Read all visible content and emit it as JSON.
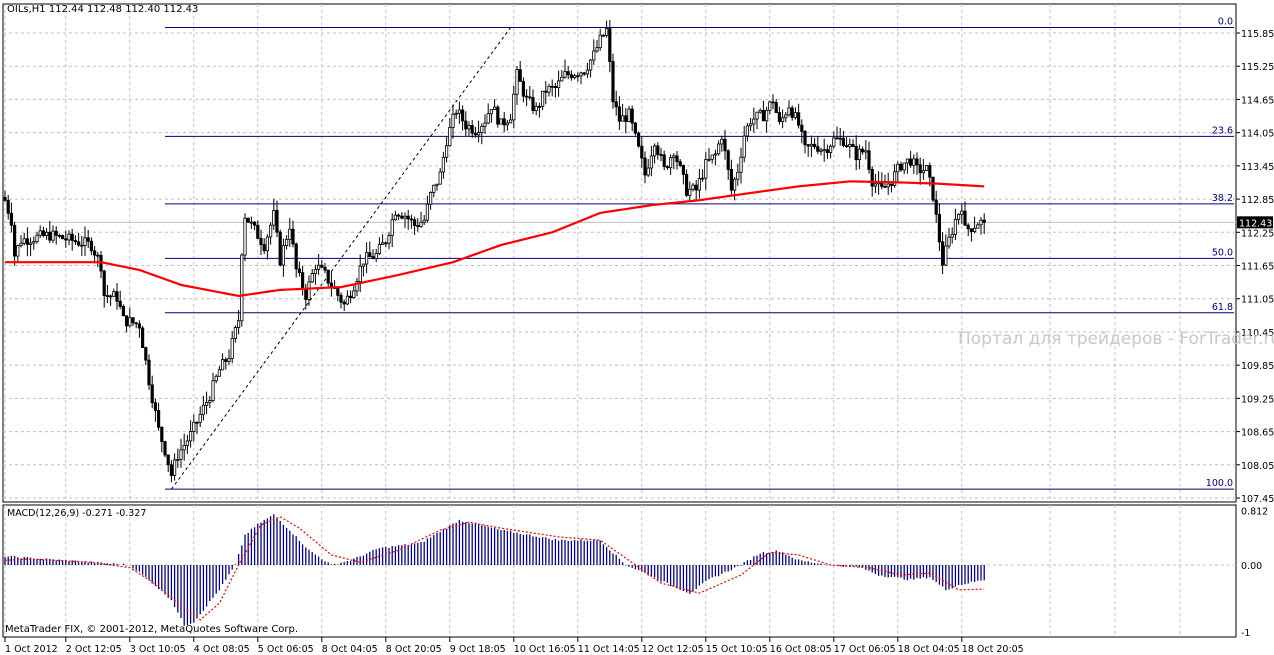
{
  "header": {
    "symbol": "OILs,H1",
    "ohlc": "112.44 112.48 112.40 112.43"
  },
  "macd_header": "MACD(12,26,9) -0.271 -0.327",
  "copyright": "MetaTrader FIX, © 2001-2012, MetaQuotes Software Corp.",
  "watermark": "Портал для трейдеров - ForTrader.ru",
  "current_price_label": "112.43",
  "chart_data": [
    {
      "type": "candlestick",
      "title": "OILs,H1",
      "timeframe": "H1",
      "current_price": 112.43,
      "ylim": [
        107.3,
        116.35
      ],
      "y_ticks": [
        "115.85",
        "115.25",
        "114.65",
        "114.05",
        "113.45",
        "112.85",
        "112.25",
        "111.65",
        "111.05",
        "110.45",
        "109.85",
        "109.25",
        "108.65",
        "108.05",
        "107.45"
      ],
      "x_ticks": [
        {
          "bar": 0,
          "label": "1 Oct 2012"
        },
        {
          "bar": 19,
          "label": "2 Oct 12:05"
        },
        {
          "bar": 39,
          "label": "3 Oct 10:05"
        },
        {
          "bar": 59,
          "label": "4 Oct 08:05"
        },
        {
          "bar": 79,
          "label": "5 Oct 06:05"
        },
        {
          "bar": 99,
          "label": "8 Oct 04:05"
        },
        {
          "bar": 119,
          "label": "8 Oct 20:05"
        },
        {
          "bar": 139,
          "label": "9 Oct 18:05"
        },
        {
          "bar": 159,
          "label": "10 Oct 16:05"
        },
        {
          "bar": 179,
          "label": "11 Oct 14:05"
        },
        {
          "bar": 199,
          "label": "12 Oct 12:05"
        },
        {
          "bar": 219,
          "label": "15 Oct 10:05"
        },
        {
          "bar": 239,
          "label": "16 Oct 08:05"
        },
        {
          "bar": 259,
          "label": "17 Oct 06:05"
        },
        {
          "bar": 279,
          "label": "18 Oct 04:05"
        },
        {
          "bar": 299,
          "label": "18 Oct 20:05"
        }
      ],
      "bar_count": 307,
      "close_path": [
        [
          0,
          112.83
        ],
        [
          2,
          112.47
        ],
        [
          3,
          111.84
        ],
        [
          5,
          112.11
        ],
        [
          14,
          112.2
        ],
        [
          27,
          112.02
        ],
        [
          30,
          111.66
        ],
        [
          31,
          111.12
        ],
        [
          35,
          111.08
        ],
        [
          37,
          110.67
        ],
        [
          42,
          110.58
        ],
        [
          45,
          109.58
        ],
        [
          48,
          108.68
        ],
        [
          50,
          108.32
        ],
        [
          52,
          107.87
        ],
        [
          54,
          108.23
        ],
        [
          58,
          108.59
        ],
        [
          61,
          108.95
        ],
        [
          64,
          109.31
        ],
        [
          67,
          109.76
        ],
        [
          70,
          110.03
        ],
        [
          73,
          110.67
        ],
        [
          74,
          111.93
        ],
        [
          75,
          112.56
        ],
        [
          78,
          112.29
        ],
        [
          81,
          112.02
        ],
        [
          84,
          112.56
        ],
        [
          86,
          111.75
        ],
        [
          89,
          112.38
        ],
        [
          91,
          111.57
        ],
        [
          94,
          111.12
        ],
        [
          97,
          111.66
        ],
        [
          100,
          111.48
        ],
        [
          103,
          111.21
        ],
        [
          106,
          110.94
        ],
        [
          109,
          111.3
        ],
        [
          112,
          111.75
        ],
        [
          116,
          111.84
        ],
        [
          119,
          112.11
        ],
        [
          122,
          112.65
        ],
        [
          125,
          112.56
        ],
        [
          128,
          112.38
        ],
        [
          131,
          112.47
        ],
        [
          133,
          112.92
        ],
        [
          136,
          113.29
        ],
        [
          138,
          113.92
        ],
        [
          141,
          114.46
        ],
        [
          144,
          114.19
        ],
        [
          147,
          114.1
        ],
        [
          150,
          114.28
        ],
        [
          152,
          114.55
        ],
        [
          155,
          114.19
        ],
        [
          158,
          114.37
        ],
        [
          160,
          115.09
        ],
        [
          163,
          114.64
        ],
        [
          166,
          114.46
        ],
        [
          169,
          114.82
        ],
        [
          172,
          114.85
        ],
        [
          175,
          115.09
        ],
        [
          181,
          115.18
        ],
        [
          184,
          115.45
        ],
        [
          186,
          115.72
        ],
        [
          188,
          115.9
        ],
        [
          190,
          114.64
        ],
        [
          192,
          114.28
        ],
        [
          195,
          114.37
        ],
        [
          198,
          113.74
        ],
        [
          200,
          113.29
        ],
        [
          203,
          113.92
        ],
        [
          206,
          113.38
        ],
        [
          209,
          113.74
        ],
        [
          213,
          113.01
        ],
        [
          216,
          113.01
        ],
        [
          219,
          113.47
        ],
        [
          222,
          113.65
        ],
        [
          224,
          114.01
        ],
        [
          227,
          113.01
        ],
        [
          229,
          113.38
        ],
        [
          231,
          114.01
        ],
        [
          233,
          114.28
        ],
        [
          237,
          114.37
        ],
        [
          240,
          114.64
        ],
        [
          242,
          114.19
        ],
        [
          245,
          114.55
        ],
        [
          248,
          114.19
        ],
        [
          250,
          113.74
        ],
        [
          253,
          113.83
        ],
        [
          256,
          113.74
        ],
        [
          259,
          113.92
        ],
        [
          262,
          113.92
        ],
        [
          266,
          113.65
        ],
        [
          269,
          113.74
        ],
        [
          271,
          113.19
        ],
        [
          274,
          113.01
        ],
        [
          277,
          113.19
        ],
        [
          280,
          113.47
        ],
        [
          283,
          113.56
        ],
        [
          285,
          113.38
        ],
        [
          288,
          113.38
        ],
        [
          290,
          112.92
        ],
        [
          292,
          112.11
        ],
        [
          293,
          111.71
        ],
        [
          295,
          112.11
        ],
        [
          297,
          112.47
        ],
        [
          299,
          112.74
        ],
        [
          300,
          112.29
        ],
        [
          303,
          112.38
        ],
        [
          304,
          112.43
        ],
        [
          306,
          112.43
        ]
      ],
      "moving_average": {
        "color": "#ff0000",
        "path": [
          [
            0,
            111.71
          ],
          [
            14,
            111.71
          ],
          [
            30,
            111.71
          ],
          [
            42,
            111.57
          ],
          [
            55,
            111.3
          ],
          [
            73,
            111.1
          ],
          [
            86,
            111.21
          ],
          [
            105,
            111.26
          ],
          [
            123,
            111.48
          ],
          [
            140,
            111.71
          ],
          [
            155,
            112.02
          ],
          [
            171,
            112.25
          ],
          [
            186,
            112.6
          ],
          [
            202,
            112.74
          ],
          [
            217,
            112.83
          ],
          [
            233,
            112.96
          ],
          [
            248,
            113.08
          ],
          [
            264,
            113.17
          ],
          [
            280,
            113.15
          ],
          [
            291,
            113.13
          ],
          [
            306,
            113.08
          ]
        ]
      },
      "trendline": {
        "from": [
          52,
          107.61
        ],
        "to": [
          158,
          115.95
        ],
        "style": "dashed"
      },
      "fibonacci": {
        "start_bar": 50,
        "price_0": 115.95,
        "price_100": 107.61,
        "color": "#000080",
        "levels": [
          {
            "pct": 0,
            "label": "0.0"
          },
          {
            "pct": 23.6,
            "label": "23.6"
          },
          {
            "pct": 38.2,
            "label": "38.2"
          },
          {
            "pct": 50,
            "label": "50.0"
          },
          {
            "pct": 61.8,
            "label": "61.8"
          },
          {
            "pct": 100,
            "label": "100.0"
          }
        ]
      }
    },
    {
      "type": "bar",
      "title": "MACD(12,26,9)",
      "macd": -0.271,
      "signal": -0.327,
      "ylim": [
        -1.0,
        0.88
      ],
      "y_ticks": [
        {
          "value": 0.812,
          "label": "0.812"
        },
        {
          "value": 0,
          "label": "0.00"
        },
        {
          "value": -1,
          "label": "-1"
        }
      ],
      "histogram_color": "#000080",
      "signal_color": "#ff0000",
      "histogram_path": [
        [
          0,
          0.13
        ],
        [
          27,
          0.04
        ],
        [
          39,
          0
        ],
        [
          45,
          -0.22
        ],
        [
          52,
          -0.52
        ],
        [
          56,
          -0.9
        ],
        [
          59,
          -0.85
        ],
        [
          67,
          -0.37
        ],
        [
          72,
          0
        ],
        [
          75,
          0.45
        ],
        [
          80,
          0.64
        ],
        [
          84,
          0.75
        ],
        [
          89,
          0.52
        ],
        [
          95,
          0.22
        ],
        [
          102,
          0
        ],
        [
          108,
          0.07
        ],
        [
          117,
          0.25
        ],
        [
          130,
          0.33
        ],
        [
          142,
          0.67
        ],
        [
          155,
          0.52
        ],
        [
          173,
          0.37
        ],
        [
          186,
          0.37
        ],
        [
          194,
          0
        ],
        [
          199,
          -0.1
        ],
        [
          208,
          -0.3
        ],
        [
          214,
          -0.42
        ],
        [
          220,
          -0.22
        ],
        [
          230,
          0
        ],
        [
          236,
          0.18
        ],
        [
          242,
          0.21
        ],
        [
          248,
          0.07
        ],
        [
          258,
          0
        ],
        [
          267,
          -0.03
        ],
        [
          273,
          -0.15
        ],
        [
          283,
          -0.22
        ],
        [
          289,
          -0.18
        ],
        [
          294,
          -0.37
        ],
        [
          298,
          -0.3
        ],
        [
          306,
          -0.22
        ]
      ],
      "signal_path": [
        [
          0,
          0.07
        ],
        [
          8,
          0.09
        ],
        [
          27,
          0.04
        ],
        [
          39,
          -0.04
        ],
        [
          45,
          -0.22
        ],
        [
          55,
          -0.6
        ],
        [
          61,
          -0.82
        ],
        [
          67,
          -0.57
        ],
        [
          73,
          0
        ],
        [
          80,
          0.6
        ],
        [
          86,
          0.72
        ],
        [
          92,
          0.55
        ],
        [
          102,
          0.15
        ],
        [
          111,
          0.04
        ],
        [
          123,
          0.22
        ],
        [
          136,
          0.52
        ],
        [
          145,
          0.64
        ],
        [
          155,
          0.55
        ],
        [
          173,
          0.42
        ],
        [
          186,
          0.37
        ],
        [
          195,
          0.07
        ],
        [
          205,
          -0.27
        ],
        [
          217,
          -0.42
        ],
        [
          230,
          -0.15
        ],
        [
          239,
          0.19
        ],
        [
          248,
          0.15
        ],
        [
          258,
          0
        ],
        [
          270,
          -0.04
        ],
        [
          280,
          -0.15
        ],
        [
          289,
          -0.12
        ],
        [
          298,
          -0.37
        ],
        [
          306,
          -0.36
        ]
      ]
    }
  ]
}
